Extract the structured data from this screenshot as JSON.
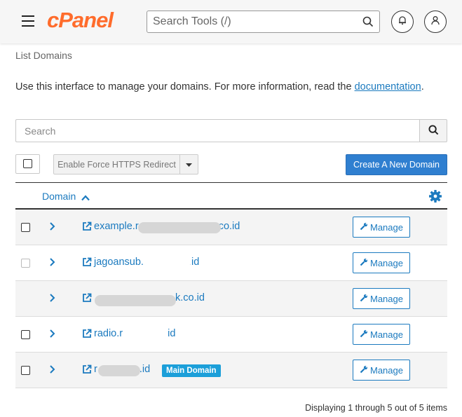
{
  "header": {
    "logo_text": "cPanel",
    "search_placeholder": "Search Tools (/)"
  },
  "breadcrumb": "List Domains",
  "intro": {
    "text": "Use this interface to manage your domains. For more information, read the ",
    "link": "documentation",
    "suffix": "."
  },
  "search": {
    "placeholder": "Search"
  },
  "toolbar": {
    "force_https_label": "Enable Force HTTPS Redirect",
    "create_label": "Create A New Domain"
  },
  "table": {
    "column_domain": "Domain",
    "manage_label": "Manage",
    "rows": [
      {
        "prefix": "example.r",
        "suffix": ".co.id",
        "checkbox": "enabled"
      },
      {
        "prefix": "jagoansub.",
        "suffix": ".id",
        "checkbox": "disabled"
      },
      {
        "prefix": "",
        "suffix": "k.co.id",
        "checkbox": "none"
      },
      {
        "prefix": "radio.r",
        "suffix": "id",
        "checkbox": "enabled"
      },
      {
        "prefix": "r",
        "suffix": ".id",
        "checkbox": "enabled",
        "badge": "Main Domain"
      }
    ]
  },
  "footer": "Displaying 1 through 5 out of 5 items",
  "colors": {
    "accent": "#1b7abf",
    "brand": "#ff6c2c",
    "primary_button": "#2f7fd0",
    "badge": "#1c9fd9"
  }
}
